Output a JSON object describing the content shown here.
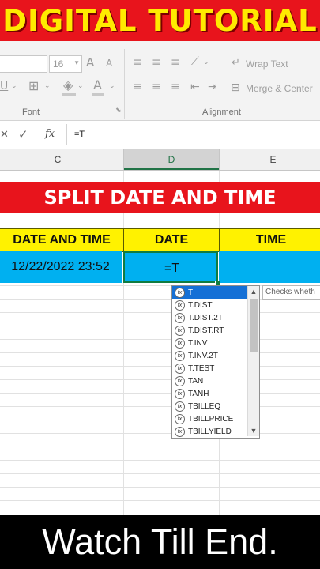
{
  "top_banner": {
    "text": "DIGITAL TUTORIAL"
  },
  "ribbon": {
    "font_size": "16",
    "grow_font": "A",
    "shrink_font": "A",
    "underline": "U",
    "font_color": "A",
    "wrap_text": "Wrap Text",
    "merge_center": "Merge & Center",
    "font_group": "Font",
    "alignment_group": "Alignment"
  },
  "formula_bar": {
    "cancel": "✕",
    "enter": "✓",
    "fx": "fx",
    "content": "=T"
  },
  "columns": [
    "C",
    "D",
    "E"
  ],
  "banner_title": "SPLIT DATE AND TIME",
  "table": {
    "headers": [
      "DATE AND TIME",
      "DATE",
      "TIME"
    ],
    "row": [
      "12/22/2022 23:52",
      "=T",
      ""
    ]
  },
  "autocomplete": {
    "items": [
      "T",
      "T.DIST",
      "T.DIST.2T",
      "T.DIST.RT",
      "T.INV",
      "T.INV.2T",
      "T.TEST",
      "TAN",
      "TANH",
      "TBILLEQ",
      "TBILLPRICE",
      "TBILLYIELD"
    ],
    "selected": "T"
  },
  "tooltip": "Checks wheth",
  "bottom_banner": {
    "text": "Watch Till End."
  },
  "colors": {
    "red": "#e8141c",
    "yellow": "#fff200",
    "cyan": "#00b0f0",
    "selection": "#1570d6"
  }
}
